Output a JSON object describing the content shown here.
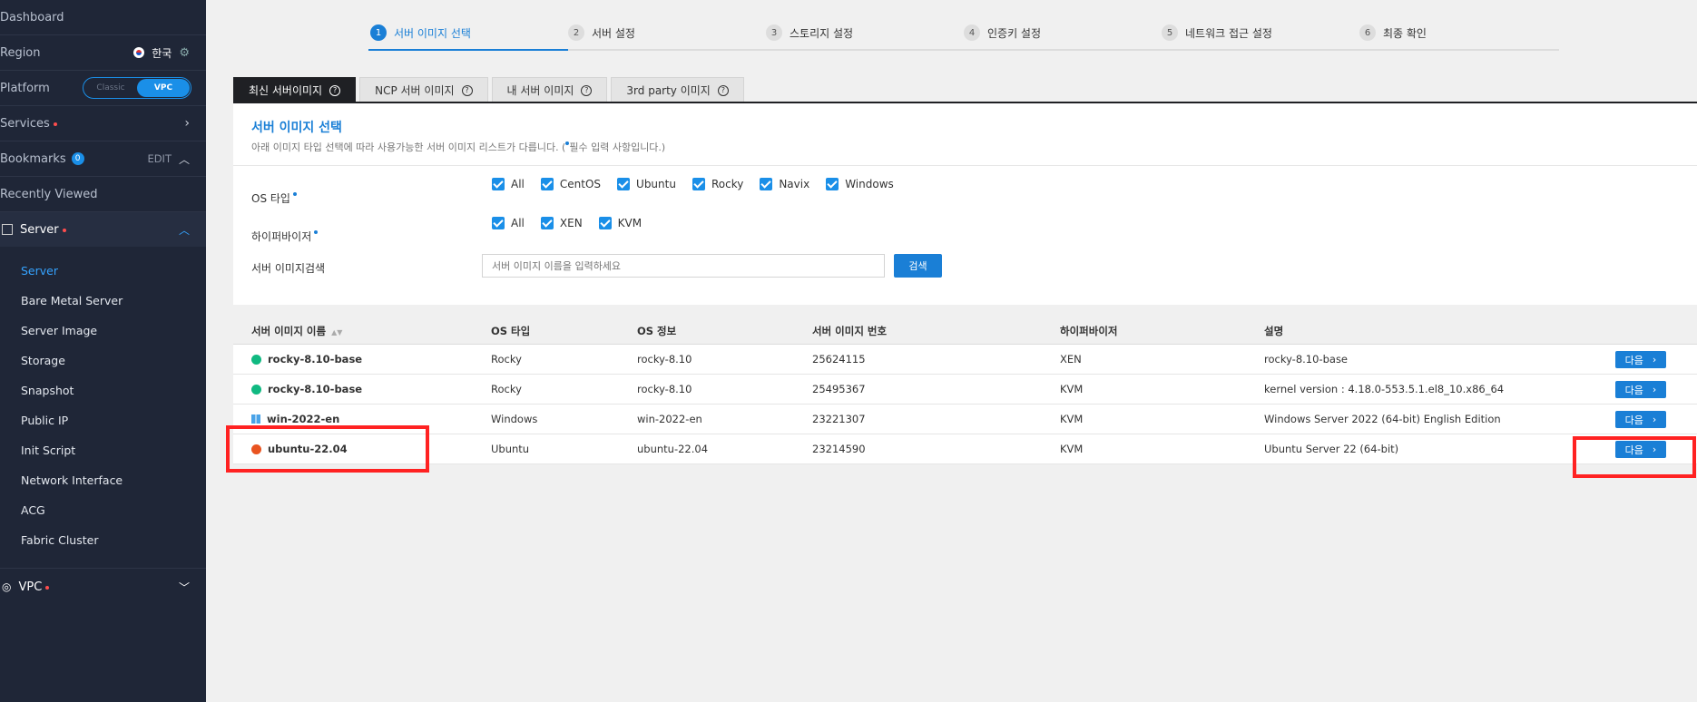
{
  "sidebar": {
    "dashboard": "Dashboard",
    "region": {
      "label": "Region",
      "value": "한국"
    },
    "platform": {
      "label": "Platform",
      "options": [
        "Classic",
        "VPC"
      ],
      "selected": "VPC"
    },
    "services": "Services",
    "bookmarks": {
      "label": "Bookmarks",
      "count": "0",
      "edit": "EDIT"
    },
    "recently_viewed": "Recently Viewed",
    "server_group": "Server",
    "server_items": [
      "Server",
      "Bare Metal Server",
      "Server Image",
      "Storage",
      "Snapshot",
      "Public IP",
      "Init Script",
      "Network Interface",
      "ACG",
      "Fabric Cluster"
    ],
    "vpc": "VPC"
  },
  "steps": [
    {
      "num": "1",
      "label": "서버 이미지 선택"
    },
    {
      "num": "2",
      "label": "서버 설정"
    },
    {
      "num": "3",
      "label": "스토리지 설정"
    },
    {
      "num": "4",
      "label": "인증키 설정"
    },
    {
      "num": "5",
      "label": "네트워크 접근 설정"
    },
    {
      "num": "6",
      "label": "최종 확인"
    }
  ],
  "tabs": [
    "최신 서버이미지",
    "NCP 서버 이미지",
    "내 서버 이미지",
    "3rd party 이미지"
  ],
  "filter": {
    "title": "서버 이미지 선택",
    "subtitle_pre": "아래 이미지 타입 선택에 따라 사용가능한 서버 이미지 리스트가 다릅니다. (",
    "subtitle_post": "필수 입력 사항입니다.)",
    "os_label": "OS 타입",
    "os_options": [
      "All",
      "CentOS",
      "Ubuntu",
      "Rocky",
      "Navix",
      "Windows"
    ],
    "hv_label": "하이퍼바이저",
    "hv_options": [
      "All",
      "XEN",
      "KVM"
    ],
    "search_label": "서버 이미지검색",
    "search_placeholder": "서버 이미지 이름을 입력하세요",
    "search_button": "검색"
  },
  "table": {
    "headers": [
      "서버 이미지 이름",
      "OS 타입",
      "OS 정보",
      "서버 이미지 번호",
      "하이퍼바이저",
      "설명"
    ],
    "rows": [
      {
        "name": "rocky-8.10-base",
        "os": "Rocky",
        "info": "rocky-8.10",
        "num": "25624115",
        "hv": "XEN",
        "desc": "rocky-8.10-base",
        "icon": "rocky"
      },
      {
        "name": "rocky-8.10-base",
        "os": "Rocky",
        "info": "rocky-8.10",
        "num": "25495367",
        "hv": "KVM",
        "desc": "kernel version : 4.18.0-553.5.1.el8_10.x86_64",
        "icon": "rocky"
      },
      {
        "name": "win-2022-en",
        "os": "Windows",
        "info": "win-2022-en",
        "num": "23221307",
        "hv": "KVM",
        "desc": "Windows Server 2022 (64-bit) English Edition",
        "icon": "windows"
      },
      {
        "name": "ubuntu-22.04",
        "os": "Ubuntu",
        "info": "ubuntu-22.04",
        "num": "23214590",
        "hv": "KVM",
        "desc": "Ubuntu Server 22 (64-bit)",
        "icon": "ubuntu"
      }
    ],
    "next_label": "다음"
  },
  "colors": {
    "accent": "#1a7fd6",
    "sidebar": "#1f2637",
    "highlight": "#ff2222"
  }
}
